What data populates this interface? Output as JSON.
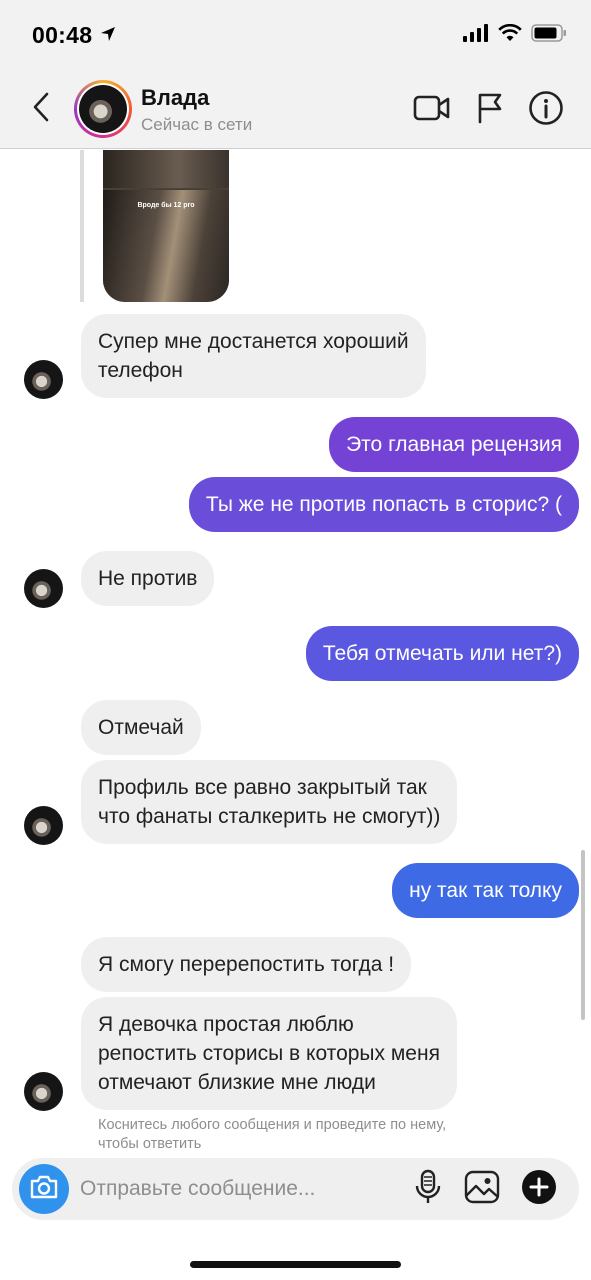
{
  "status_bar": {
    "time": "00:48"
  },
  "header": {
    "contact_name": "Влада",
    "contact_status": "Сейчас в сети"
  },
  "shared_post": {
    "caption": "Вроде бы 12 pro"
  },
  "messages": [
    {
      "side": "in",
      "text_lines": [
        "Супер мне достанется хороший",
        "телефон"
      ]
    },
    {
      "side": "out",
      "text": "Это главная рецензия"
    },
    {
      "side": "out",
      "text": "Ты же не против попасть в сторис? ("
    },
    {
      "side": "in",
      "text": "Не против"
    },
    {
      "side": "out",
      "text": "Тебя отмечать или нет?)"
    },
    {
      "side": "in",
      "text": "Отмечай"
    },
    {
      "side": "in",
      "text_lines": [
        "Профиль все равно закрытый так",
        "что фанаты сталкерить не смогут))"
      ]
    },
    {
      "side": "out",
      "text": "ну так так толку"
    },
    {
      "side": "in",
      "text": "Я смогу перерепостить тогда !"
    },
    {
      "side": "in",
      "text_lines": [
        "Я девочка простая люблю",
        "репостить сторисы в которых меня",
        "отмечают близкие мне люди"
      ]
    }
  ],
  "reply_hint": "Коснитесь любого сообщения и проведите по нему, чтобы ответить",
  "composer": {
    "placeholder": "Отправьте сообщение..."
  },
  "colors": {
    "outgoing_top": "#7a4ad8",
    "outgoing_bottom": "#3f6ae6",
    "incoming_bg": "#efefef",
    "camera_button": "#2f93ee"
  },
  "icons": {
    "back": "chevron-left-icon",
    "video": "video-camera-icon",
    "flag": "flag-icon",
    "info": "info-icon",
    "camera": "camera-icon",
    "mic": "microphone-icon",
    "gallery": "image-icon",
    "add": "plus-icon"
  }
}
